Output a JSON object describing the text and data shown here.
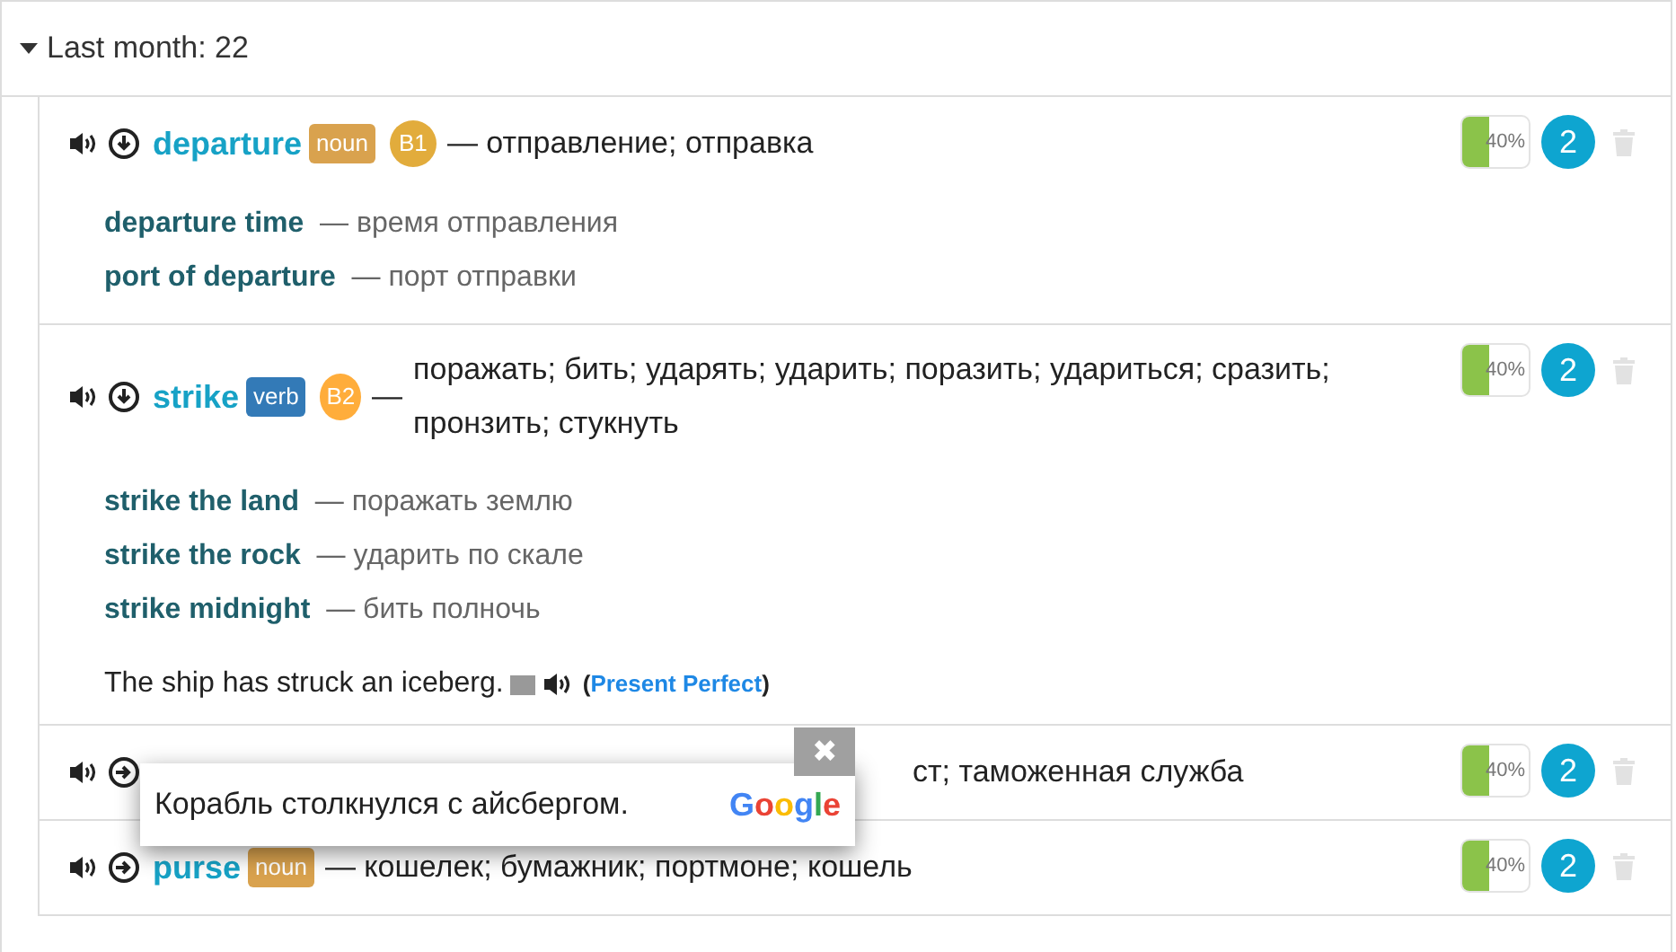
{
  "group": {
    "title": "Last month: 22",
    "expanded": true
  },
  "words": [
    {
      "word": "departure",
      "pos": {
        "label": "noun",
        "color": "#d9a24e"
      },
      "cefr": {
        "label": "B1",
        "color": "#e2ac3c"
      },
      "translation": "— отправление; отправка",
      "expanded": true,
      "progress": {
        "level": 0.4,
        "reading": "40%"
      },
      "count": "2",
      "phrases": [
        {
          "phrase": "departure time",
          "translation": "— время отправления"
        },
        {
          "phrase": "port of departure",
          "translation": "— порт отправки"
        }
      ]
    },
    {
      "word": "strike",
      "pos": {
        "label": "verb",
        "color": "#337ab7"
      },
      "cefr": {
        "label": "B2",
        "color": "#ffad3b"
      },
      "dash": "—",
      "translation": "поражать; бить; ударять; ударить; поразить; удариться; сразить; пронзить; стукнуть",
      "expanded": true,
      "progress": {
        "level": 0.4,
        "reading": "40%"
      },
      "count": "2",
      "phrases": [
        {
          "phrase": "strike the land",
          "translation": "— поражать землю"
        },
        {
          "phrase": "strike the rock",
          "translation": "— ударить по скале"
        },
        {
          "phrase": "strike midnight",
          "translation": "— бить полночь"
        }
      ],
      "example": {
        "sentence": "The ship has struck an iceberg.",
        "open": "(",
        "tense": "Present Perfect",
        "close": ")"
      }
    },
    {
      "translation": "ст; таможенная служба",
      "expanded": false,
      "progress": {
        "level": 0.4,
        "reading": "40%"
      },
      "count": "2"
    },
    {
      "word": "purse",
      "pos": {
        "label": "noun",
        "color": "#d9a24e"
      },
      "translation": "— кошелек; бумажник; портмоне; кошель",
      "expanded": false,
      "progress": {
        "level": 0.4,
        "reading": "40%"
      },
      "count": "2"
    }
  ],
  "translation_popup": {
    "text": "Корабль столкнулся с айсбергом.",
    "brand": "Google",
    "close": "✖"
  }
}
